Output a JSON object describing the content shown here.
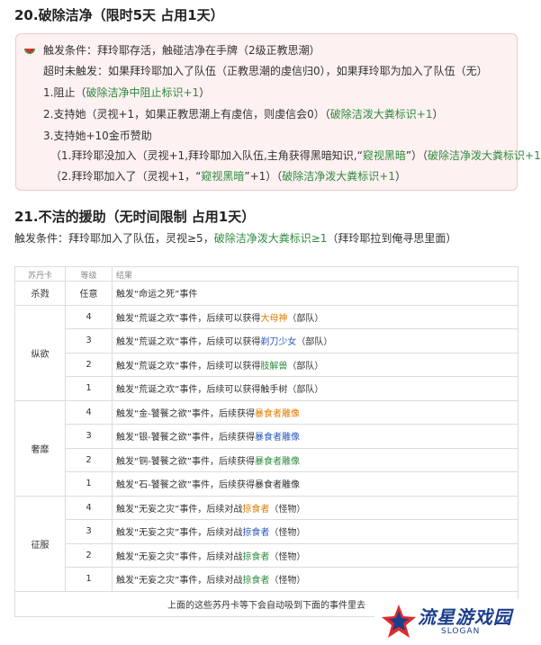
{
  "section20": {
    "title": "20.破除洁净（限时5天 占用1天）",
    "trigger": "触发条件：拜玲耶存活，触碰洁净在手牌（2级正教思潮）",
    "timeout": "超时未触发：如果拜玲耶加入了队伍（正教思潮的虔信归0），如果拜玲耶为加入了队伍（无）",
    "o1_text": "1.阻止（",
    "o1_hl": "破除洁净中阻止标识+1",
    "o1_end": "）",
    "o2_text": "2.支持她（灵视+1，如果正教思潮上有虔信，则虔信会0）（",
    "o2_hl": "破除洁泼大粪标识+1",
    "o2_end": "）",
    "o3_text": "3.支持她+10金币赞助",
    "s1_text": "（1.拜玲耶没加入（灵视+1,拜玲耶加入队伍,主角获得黑暗知识,“",
    "s1_hl1": "窥视黑暗",
    "s1_mid": "”）（",
    "s1_hl2": "破除洁净泼大粪标识+1",
    "s1_end": "）",
    "s2_text": "（2.拜玲耶加入了（灵视+1，“",
    "s2_hl1": "窥视黑暗",
    "s2_mid": "”+1）（",
    "s2_hl2": "破除洁净泼大粪标识+1",
    "s2_end": "）"
  },
  "section21": {
    "title": "21.不洁的援助（无时间限制 占用1天）",
    "trigger_text": "触发条件：拜玲耶加入了队伍，灵视≥5，",
    "trigger_hl": "破除洁净泼大粪标识≥1",
    "trigger_end": "（拜玲耶拉到俺寻思里面）"
  },
  "table": {
    "headers": [
      "苏丹卡",
      "等级",
      "结果"
    ],
    "killing": {
      "card": "杀戮",
      "level": "任意",
      "text": "触发“命运之死”事件"
    },
    "lust": {
      "card": "纵欲",
      "rows": [
        {
          "level": "4",
          "text": "触发“荒诞之欢”事件，后续可以获得",
          "hl": "大母神",
          "end": "（部队）"
        },
        {
          "level": "3",
          "text": "触发“荒诞之欢”事件，后续可以获得",
          "hl": "剃刀少女",
          "end": "（部队）"
        },
        {
          "level": "2",
          "text": "触发“荒诞之欢”事件，后续可以获得",
          "hl": "肢解兽",
          "end": "（部队）"
        },
        {
          "level": "1",
          "text": "触发“荒诞之欢”事件，后续可以获得触手树",
          "hl": "",
          "end": "（部队）"
        }
      ]
    },
    "luxury": {
      "card": "奢靡",
      "rows": [
        {
          "level": "4",
          "text": "触发“金-饕餮之欲”事件，后续获得",
          "hl": "暴食者雕像"
        },
        {
          "level": "3",
          "text": "触发“银-饕餮之欲”事件，后续获得",
          "hl": "暴食者雕像"
        },
        {
          "level": "2",
          "text": "触发“铜-饕餮之欲”事件，后续获得",
          "hl": "暴食者雕像"
        },
        {
          "level": "1",
          "text": "触发“石-饕餮之欲”事件，后续获得暴食者雕像",
          "hl": ""
        }
      ]
    },
    "conquest": {
      "card": "征服",
      "rows": [
        {
          "level": "4",
          "text": "触发“无妄之灾”事件，后续对战",
          "hl": "掠食者",
          "end": "（怪物）"
        },
        {
          "level": "3",
          "text": "触发“无妄之灾”事件，后续对战",
          "hl": "掠食者",
          "end": "（怪物）"
        },
        {
          "level": "2",
          "text": "触发“无妄之灾”事件，后续对战",
          "hl": "掠食者",
          "end": "（怪物）"
        },
        {
          "level": "1",
          "text": "触发“无妄之灾”事件，后续对战",
          "hl": "掠食者",
          "end": "（怪物）"
        }
      ]
    },
    "footer": "上面的这些苏丹卡等下会自动吸到下面的事件里去"
  },
  "logo": {
    "text": "流星游戏园",
    "slogan": "SLOGAN"
  },
  "icons": {
    "box": "watermelon-icon",
    "logo": "star-icon"
  }
}
